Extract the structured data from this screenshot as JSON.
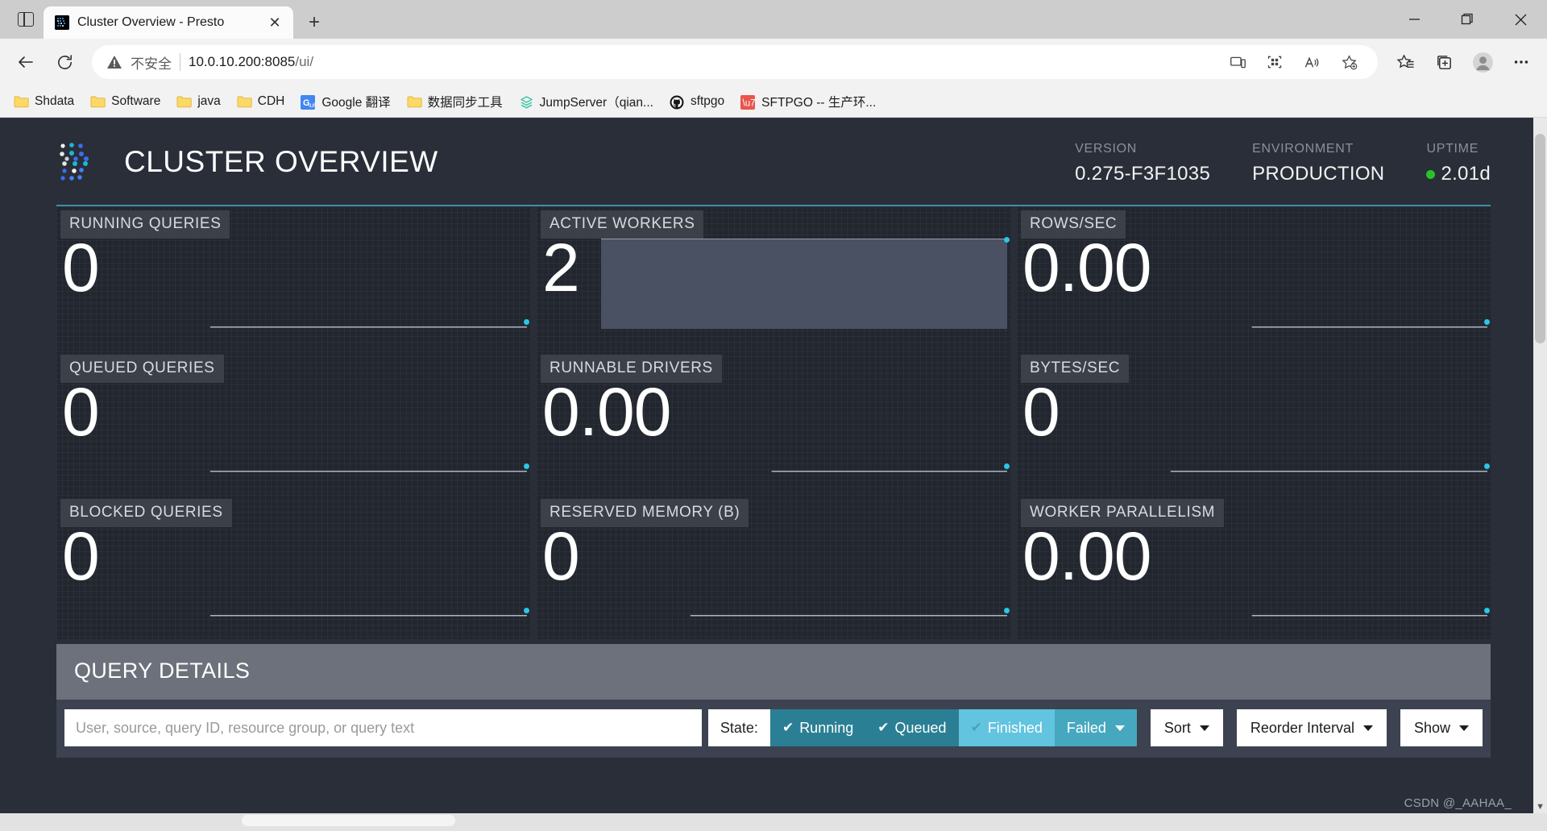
{
  "window": {
    "minimize_label": "minimize-window",
    "maximize_label": "restore-window",
    "close_label": "close-window"
  },
  "tab": {
    "title": "Cluster Overview - Presto",
    "close_label": "✕",
    "new_tab_label": "+"
  },
  "omnibox": {
    "security_label": "不安全",
    "url_main": "10.0.10.200:8085",
    "url_path": "/ui/"
  },
  "bookmarks": [
    {
      "label": "Shdata",
      "icon": "folder-icon"
    },
    {
      "label": "Software",
      "icon": "folder-icon"
    },
    {
      "label": "java",
      "icon": "folder-icon"
    },
    {
      "label": "CDH",
      "icon": "folder-icon"
    },
    {
      "label": "Google 翻译",
      "icon": "google-translate-icon"
    },
    {
      "label": "数据同步工具",
      "icon": "folder-icon"
    },
    {
      "label": "JumpServer（qian...",
      "icon": "jumpserver-icon"
    },
    {
      "label": "sftpgo",
      "icon": "github-icon"
    },
    {
      "label": "SFTPGO -- 生产环...",
      "icon": "jianshu-icon"
    }
  ],
  "header": {
    "title": "CLUSTER OVERVIEW",
    "meta": [
      {
        "key": "VERSION",
        "value": "0.275-F3F1035",
        "status": false
      },
      {
        "key": "ENVIRONMENT",
        "value": "PRODUCTION",
        "status": false
      },
      {
        "key": "UPTIME",
        "value": "2.01d",
        "status": true
      }
    ],
    "accent_color": "#3d8ea8",
    "status_dot_color": "#25c425"
  },
  "stats": [
    {
      "label": "RUNNING QUERIES",
      "value": "0",
      "spark_fill": 0.02,
      "spark_start": 0.22
    },
    {
      "label": "ACTIVE WORKERS",
      "value": "2",
      "spark_fill": 1.0,
      "spark_start": 0.0
    },
    {
      "label": "ROWS/SEC",
      "value": "0.00",
      "spark_fill": 0.02,
      "spark_start": 0.42
    },
    {
      "label": "QUEUED QUERIES",
      "value": "0",
      "spark_fill": 0.02,
      "spark_start": 0.22
    },
    {
      "label": "RUNNABLE DRIVERS",
      "value": "0.00",
      "spark_fill": 0.02,
      "spark_start": 0.42
    },
    {
      "label": "BYTES/SEC",
      "value": "0",
      "spark_fill": 0.02,
      "spark_start": 0.22
    },
    {
      "label": "BLOCKED QUERIES",
      "value": "0",
      "spark_fill": 0.02,
      "spark_start": 0.22
    },
    {
      "label": "RESERVED MEMORY (B)",
      "value": "0",
      "spark_fill": 0.02,
      "spark_start": 0.22
    },
    {
      "label": "WORKER PARALLELISM",
      "value": "0.00",
      "spark_fill": 0.02,
      "spark_start": 0.42
    }
  ],
  "query_details": {
    "title": "QUERY DETAILS",
    "search_placeholder": "User, source, query ID, resource group, or query text",
    "search_value": "",
    "state_label": "State:",
    "state_filters": [
      {
        "label": "Running",
        "checked": true,
        "style": "on"
      },
      {
        "label": "Queued",
        "checked": true,
        "style": "on"
      },
      {
        "label": "Finished",
        "checked": true,
        "style": "finished"
      },
      {
        "label": "Failed",
        "checked": false,
        "style": "failed",
        "caret": true
      }
    ],
    "menus": [
      {
        "label": "Sort"
      },
      {
        "label": "Reorder Interval"
      },
      {
        "label": "Show"
      }
    ],
    "colors": {
      "active": "#2a7f94",
      "finished": "#62c4de",
      "failed": "#46a8bf",
      "header_bg": "#6d717c",
      "bar_bg": "#3c4250"
    }
  },
  "watermark": "CSDN @_AAHAA_"
}
